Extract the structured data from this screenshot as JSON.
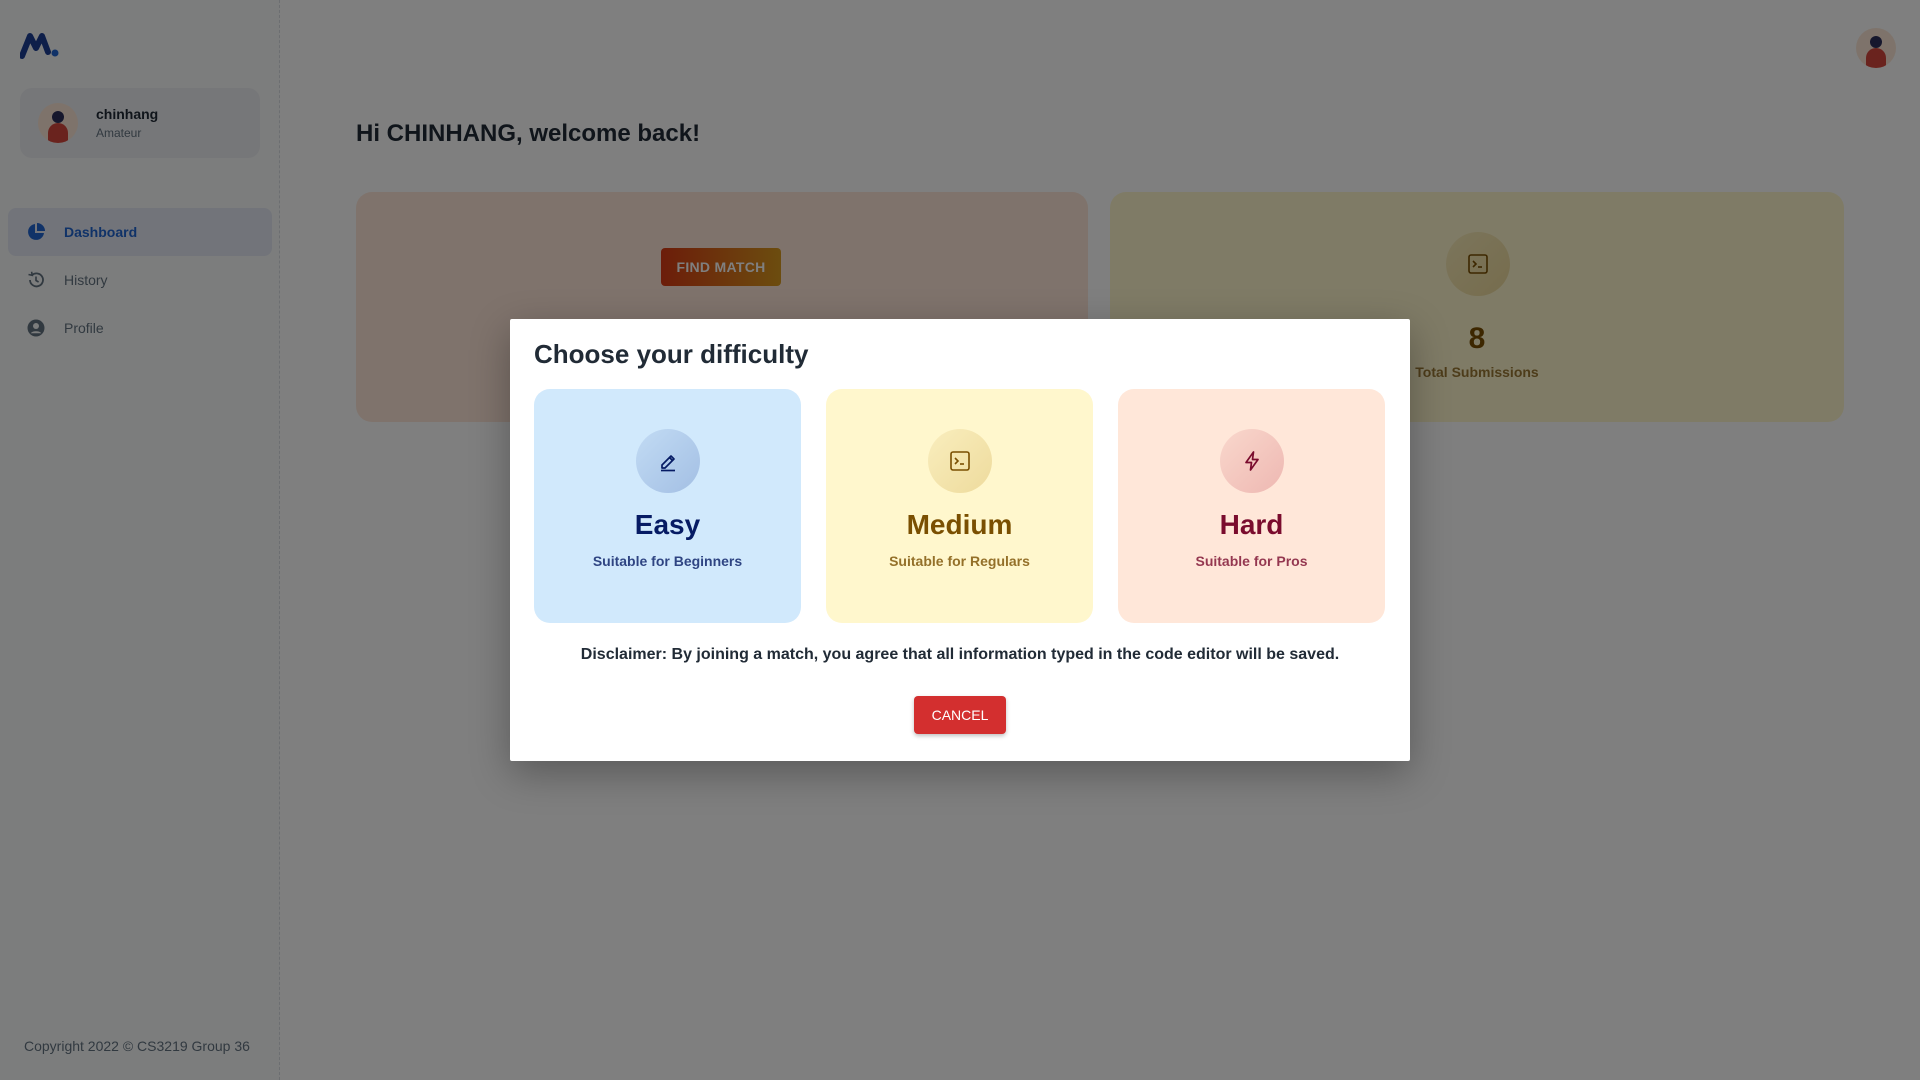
{
  "sidebar": {
    "account": {
      "name": "chinhang",
      "role": "Amateur"
    },
    "nav": [
      {
        "label": "Dashboard",
        "icon": "pie-chart-icon",
        "active": true
      },
      {
        "label": "History",
        "icon": "history-icon",
        "active": false
      },
      {
        "label": "Profile",
        "icon": "person-circle-icon",
        "active": false
      }
    ],
    "copyright": "Copyright 2022 © CS3219 Group 36"
  },
  "main": {
    "greeting": "Hi CHINHANG, welcome back!",
    "find_match_label": "FIND MATCH",
    "stat": {
      "value": "8",
      "label": "Total Submissions",
      "icon": "terminal-icon"
    }
  },
  "modal": {
    "title": "Choose your difficulty",
    "options": [
      {
        "name": "Easy",
        "subtitle": "Suitable for Beginners",
        "icon": "pencil-icon",
        "color": "#061b64",
        "bg": "#d1e9fc"
      },
      {
        "name": "Medium",
        "subtitle": "Suitable for Regulars",
        "icon": "terminal-icon",
        "color": "#7a4f01",
        "bg": "#fff7cd"
      },
      {
        "name": "Hard",
        "subtitle": "Suitable for Pros",
        "icon": "lightning-icon",
        "color": "#7a0c2e",
        "bg": "#ffe7d9"
      }
    ],
    "disclaimer": "Disclaimer: By joining a match, you agree that all information typed in the code editor will be saved.",
    "cancel_label": "CANCEL"
  },
  "colors": {
    "primary": "#2065d1",
    "cancel": "#d32f2f"
  }
}
